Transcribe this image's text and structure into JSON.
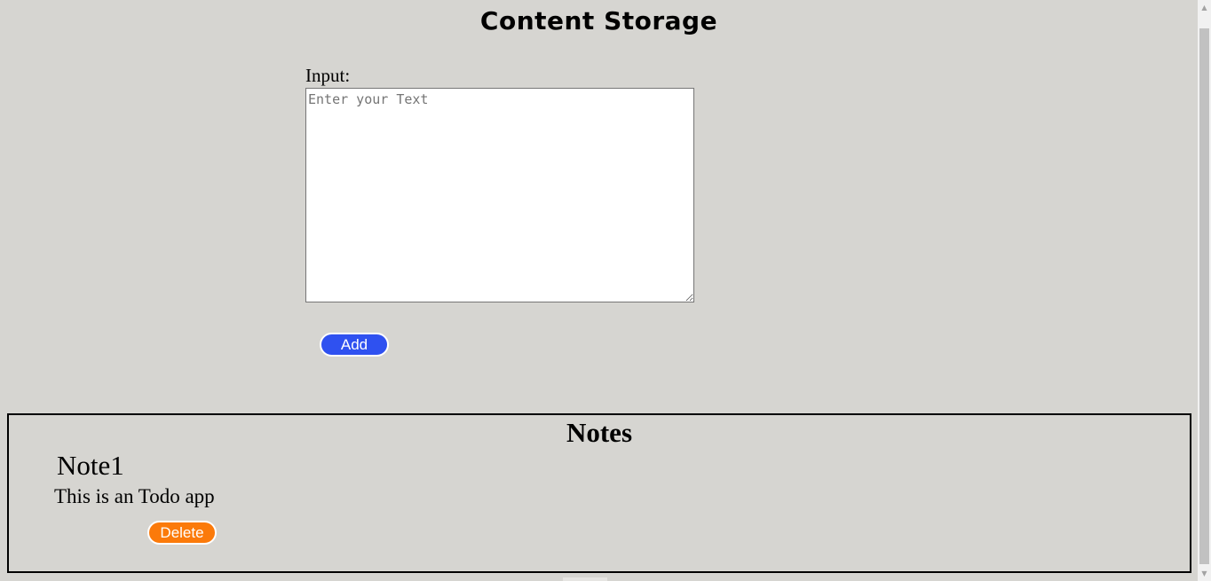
{
  "app": {
    "title": "Content Storage"
  },
  "form": {
    "input_label": "Input:",
    "input_placeholder": "Enter your Text",
    "input_value": "",
    "add_label": "Add",
    "add_color": "#2f51f0"
  },
  "notes": {
    "heading": "Notes",
    "items": [
      {
        "title": "Note1",
        "body": "This is an Todo app",
        "delete_label": "Delete",
        "delete_color": "#fb7a0a"
      }
    ]
  },
  "icons": {
    "scroll_up": "chevron-up-icon",
    "scroll_down": "chevron-down-icon"
  }
}
